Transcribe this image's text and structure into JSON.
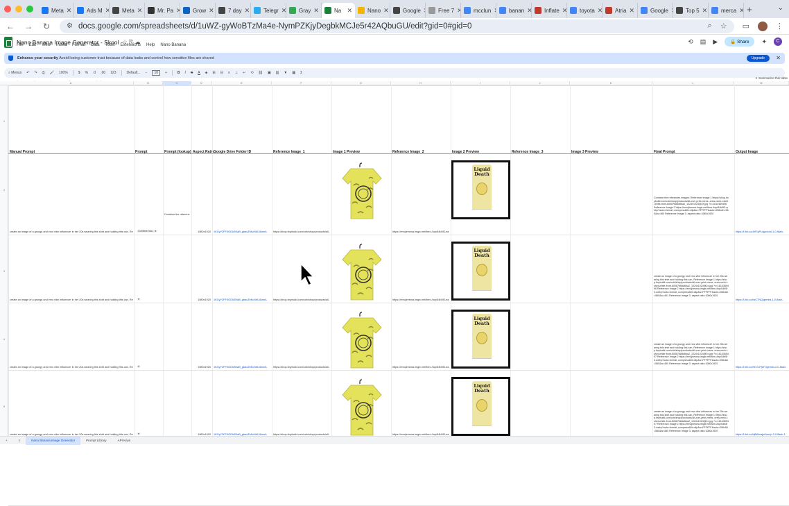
{
  "browser": {
    "tabs": [
      {
        "label": "Meta",
        "color": "#1877f2"
      },
      {
        "label": "Ads M",
        "color": "#1877f2"
      },
      {
        "label": "Meta",
        "color": "#444"
      },
      {
        "label": "Mr. Pa",
        "color": "#333"
      },
      {
        "label": "Grow",
        "color": "#0a66c2"
      },
      {
        "label": "7 day",
        "color": "#444"
      },
      {
        "label": "Telegr",
        "color": "#2aabee"
      },
      {
        "label": "Gray",
        "color": "#34a853"
      },
      {
        "label": "Na",
        "color": "#188038",
        "active": true
      },
      {
        "label": "Nano",
        "color": "#f4b400"
      },
      {
        "label": "Google",
        "color": "#444"
      },
      {
        "label": "Free 7",
        "color": "#999"
      },
      {
        "label": "mcclun",
        "color": "#4285f4"
      },
      {
        "label": "banan",
        "color": "#4285f4"
      },
      {
        "label": "Inflate",
        "color": "#c0392b"
      },
      {
        "label": "toyota",
        "color": "#4285f4"
      },
      {
        "label": "Atria",
        "color": "#c0392b"
      },
      {
        "label": "Google",
        "color": "#4285f4"
      },
      {
        "label": "Top 5",
        "color": "#444"
      },
      {
        "label": "merca",
        "color": "#4285f4"
      }
    ],
    "url": "docs.google.com/spreadsheets/d/1uWZ-gyWoBTzMa4e-NymPZKjyDegbkMCJe5r42AQbuGU/edit?gid=0#gid=0"
  },
  "sheets": {
    "title": "Nano Banana Image Generator - Skool",
    "menu": [
      "File",
      "Edit",
      "View",
      "Insert",
      "Format",
      "Data",
      "Tools",
      "Extensions",
      "Help",
      "Nano Banana"
    ],
    "share_label": "Share",
    "user_initial": "C",
    "banner_bold": "Enhance your security",
    "banner_text": "Avoid losing customer trust because of data leaks and control how sensitive files are shared",
    "upgrade_label": "Upgrade",
    "toolbar": {
      "menus": "Menus",
      "zoom": "100%",
      "currency": "$",
      "percent": "%",
      "font": "Default...",
      "font_size": "10"
    },
    "cell_ref": "C5",
    "formula_prefix": "=IFNA(",
    "formula_fn": "VLOOKUP(",
    "formula_rest": "B5,'Prompt Library'!A:B,2,FALSE),\"\")",
    "summary_label": "Summarize this table"
  },
  "columns": [
    {
      "letter": "A",
      "header": "Manual Prompt"
    },
    {
      "letter": "B",
      "header": "Prompt"
    },
    {
      "letter": "C",
      "header": "Prompt (lookup)"
    },
    {
      "letter": "D",
      "header": "Aspect Ratio"
    },
    {
      "letter": "E",
      "header": "Google Drive Folder ID"
    },
    {
      "letter": "F",
      "header": "Reference Image_1"
    },
    {
      "letter": "G",
      "header": "Image 1 Preview"
    },
    {
      "letter": "H",
      "header": "Reference Image_2"
    },
    {
      "letter": "I",
      "header": "Image 2 Preview"
    },
    {
      "letter": "J",
      "header": "Reference Image_3"
    },
    {
      "letter": "K",
      "header": "Image 3 Preview"
    },
    {
      "letter": "L",
      "header": "Final Prompt"
    },
    {
      "letter": "M",
      "header": "Output Image"
    }
  ],
  "rows": [
    {
      "num": "2",
      "manual": "create an image of a grungy and emo vibe influencer in her 20s wearing this shirt and holding this can, Reference im",
      "prompt": "Combine ima...",
      "lookup": "Combine the referenc",
      "aspect": "1080x1920",
      "folder": "1KGyY2FFKGDhZ0wB_gbavZhKcNbIJ4knnA",
      "ref1": "https://shop.tinybuild.com/cdn/shop/products/all-",
      "ref2": "https://emojiresma.imgix.net/item-/top/64b5f3-ea",
      "final": "Combine the references images: Reference Image 1 https://shop.tinybuild.com/cdn/shop/products/all-over-print-mens -crew-neck-t-shirt-white-front-60087b8dd6ba2_1024x1024@2x.jpg ?v=1614369496 Reference Image 2 https://emojiresma.imgix.net/item-/top/64b5f3-webp?auto=format ,compress&fit=clip&w=FFFFFF&auto=256x&h=560&w=460 Reference Image 3: aspect ratio:1080x1920",
      "output": "https://i.ibb.co/4H7qPLnjpn/out-1-0-flash-"
    },
    {
      "num": "3",
      "manual": "create an image of a grungy and emo vibe influencer in her 20s wearing this shirt and holding this can, Reference im",
      "prompt": "",
      "lookup": "",
      "aspect": "1080x1920",
      "folder": "1KGyY2FFKGDhZ0wB_gbavZhKcNbIJ4knnA",
      "ref1": "https://shop.tinybuild.com/cdn/shop/products/all-",
      "ref2": "https://emojiresma.imgix.net/item-/top/64b5f3-ea",
      "final": "create an image of a grungy and emo vibe influencer in her 20s wearing this shirt and holding this can. Reference Image 1 https://shop.tinybuild.com/cdn/shop/products/all-over-print-mens -crew-neck-t-shirt-white-front-60087b8dd6ba2_1024x1024@2x.jpg ?v=1614369496 Reference Image 2 https://emojiresma.imgix.net/item-/top/64b5f3-webp?auto=format ,compress&fit=clip&w=FFFFFF&auto=256x&h=560&w=461 Reference Image 3: aspect ratio:1080x1920",
      "output": "https://i.ibb.co/bzC7NQ/gemini-1-0-flash-"
    },
    {
      "num": "4",
      "manual": "create an image of a grungy and emo vibe influencer in her 20s wearing this shirt and holding this can, Reference im",
      "prompt": "",
      "lookup": "",
      "aspect": "1080x1920",
      "folder": "1KGyY2FFKGDhZ0wB_gbavZhKcNbIJ4knnA",
      "ref1": "https://shop.tinybuild.com/cdn/shop/products/all-",
      "ref2": "https://emojiresma.imgix.net/item-/top/64b5f3-ea",
      "final": "create an image of a grungy and emo vibe influencer in her 20s wearing this shirt and holding this can. Reference Image 1 https://shop.tinybuild.com/cdn/shop/products/all-over-print-mens -crew-neck-t-shirt-white-front-60087b8dd6ba2_1024x1024@2x.jpg ?v=1614369497 Reference Image 2 https://emojiresma.imgix.net/item-/top/64b5f3-webp?auto=format ,compress&fit=clip&w=FFFFFF&auto=256x&h=560&w=460 Reference Image 3: aspect ratio:1080x1920",
      "output": "https://i.ibb.co/HD7LPjWT/gemini-2-0-flash-"
    },
    {
      "num": "5",
      "manual": "create an image of a grungy and emo vibe influencer in her 20s wearing this shirt and holding this can, Reference im",
      "prompt": "",
      "lookup": "",
      "aspect": "1080x1920",
      "folder": "1KGyY2FFKGDhZ0wB_gbavZhKcNbIJ4knnA",
      "ref1": "https://shop.tinybuild.com/cdn/shop/products/all-",
      "ref2": "https://emojiresma.imgix.net/item-/top/64b5f3-ea",
      "final": "create an image of a grungy and emo vibe influencer in her 20s wearing this shirt and holding this can. Reference Image 1 https://shop.tinybuild.com/cdn/shop/products/all-over-print-mens -crew-neck-t-shirt-white-front-60087b8dd6ba2_1024x1024@2x.jpg ?v=1614369497 Reference Image 2 https://emojiresma.imgix.net/item-/top/64b5f3-webp?auto=format ,compress&fit=clip&w=FFFFFF&auto=256x&h=560&w=460 Reference Image 3: aspect ratio:1080x1920",
      "output": "https://i.ibb.co/bj8WmajwJmn/p-2-0-flash-1"
    }
  ],
  "can_logo": "Liquid Death",
  "sheet_tabs": [
    {
      "label": "Nano Banana Image Generator",
      "active": true
    },
    {
      "label": "Prompt Library"
    },
    {
      "label": "API Keys"
    }
  ],
  "colors": {
    "accent": "#0b57d0",
    "sheets_green": "#188038",
    "shirt": "#e4e25a"
  }
}
